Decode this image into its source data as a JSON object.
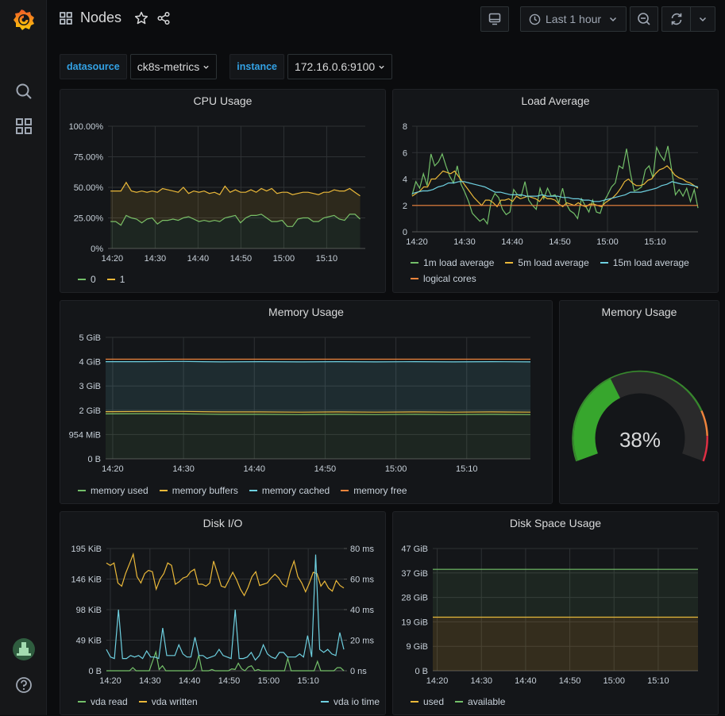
{
  "app": {
    "title": "Nodes"
  },
  "toolbar": {
    "time_range": "Last 1 hour"
  },
  "variables": [
    {
      "label": "datasource",
      "value": "ck8s-metrics"
    },
    {
      "label": "instance",
      "value": "172.16.0.6:9100"
    }
  ],
  "colors": {
    "green": "#73bf69",
    "yellow": "#eab839",
    "cyan": "#6ed0e0",
    "orange": "#ef843c",
    "red": "#e02f44",
    "gauge_green": "#37872d"
  },
  "panels": {
    "cpu": {
      "title": "CPU Usage"
    },
    "load": {
      "title": "Load Average"
    },
    "memory": {
      "title": "Memory Usage"
    },
    "memory_gauge": {
      "title": "Memory Usage",
      "value_text": "38%"
    },
    "diskio": {
      "title": "Disk I/O"
    },
    "diskspace": {
      "title": "Disk Space Usage"
    }
  },
  "chart_data": [
    {
      "id": "cpu",
      "type": "area",
      "title": "CPU Usage",
      "x": [
        "14:20",
        "14:30",
        "14:40",
        "14:50",
        "15:00",
        "15:10"
      ],
      "xlim": [
        "14:19",
        "15:19"
      ],
      "yticks": [
        "0%",
        "25.00%",
        "50.00%",
        "75.00%",
        "100.00%"
      ],
      "ylim": [
        0,
        100
      ],
      "stacked": true,
      "series": [
        {
          "name": "0",
          "color": "#73bf69",
          "values": [
            22,
            22,
            19,
            27,
            25,
            24,
            21,
            24,
            25,
            20,
            23,
            23,
            24,
            23,
            25,
            26,
            24,
            22,
            23,
            22,
            23,
            22,
            25,
            26,
            27,
            21,
            25,
            27,
            27,
            28,
            25,
            22,
            22,
            23,
            18,
            18,
            24,
            25,
            25,
            22,
            22,
            25,
            26,
            27,
            24,
            23,
            28,
            28,
            24
          ]
        },
        {
          "name": "1",
          "color": "#eab839",
          "values": [
            25,
            25,
            28,
            27,
            22,
            22,
            26,
            22,
            22,
            26,
            26,
            25,
            23,
            23,
            25,
            19,
            23,
            24,
            24,
            23,
            23,
            22,
            26,
            20,
            21,
            25,
            21,
            21,
            19,
            21,
            22,
            27,
            23,
            23,
            28,
            26,
            21,
            21,
            21,
            23,
            22,
            21,
            20,
            21,
            23,
            24,
            21,
            18,
            19
          ]
        }
      ],
      "legend": [
        "0",
        "1"
      ]
    },
    {
      "id": "load",
      "type": "line",
      "title": "Load Average",
      "x": [
        "14:20",
        "14:30",
        "14:40",
        "14:50",
        "15:00",
        "15:10"
      ],
      "yticks": [
        "0",
        "2",
        "4",
        "6",
        "8"
      ],
      "ylim": [
        0,
        8
      ],
      "series": [
        {
          "name": "1m load average",
          "color": "#73bf69",
          "values": [
            2.8,
            3.8,
            3.3,
            4.4,
            3.5,
            5.9,
            5.0,
            5.3,
            5.9,
            5.0,
            4.2,
            3.7,
            5.0,
            3.6,
            3.0,
            2.3,
            1.4,
            1.1,
            0.8,
            1.0,
            0.6,
            2.3,
            2.9,
            2.6,
            1.7,
            1.3,
            1.5,
            3.2,
            2.8,
            2.7,
            3.8,
            2.4,
            2.0,
            1.7,
            3.3,
            2.5,
            3.3,
            2.7,
            2.8,
            2.2,
            3.3,
            2.1,
            1.6,
            1.4,
            1.0,
            2.5,
            2.0,
            1.5,
            2.4,
            1.5,
            1.4,
            2.3,
            2.8,
            3.4,
            3.7,
            5.0,
            4.8,
            6.3,
            4.5,
            3.1,
            3.2,
            3.4,
            4.7,
            5.0,
            4.1,
            6.4,
            5.8,
            5.4,
            6.5,
            4.7,
            2.8,
            3.2,
            2.7,
            3.3,
            2.3,
            3.2,
            1.8
          ]
        },
        {
          "name": "5m load average",
          "color": "#eab839",
          "values": [
            2.7,
            2.9,
            3.1,
            3.4,
            3.4,
            4.0,
            4.0,
            4.3,
            4.6,
            4.5,
            4.4,
            4.6,
            4.2,
            3.8,
            3.4,
            3.0,
            2.6,
            2.3,
            2.0,
            2.4,
            2.4,
            2.2,
            1.9,
            2.4,
            2.4,
            2.5,
            2.3,
            2.7,
            2.5,
            2.6,
            2.7,
            2.6,
            2.5,
            2.3,
            2.7,
            2.5,
            2.5,
            2.4,
            2.1,
            1.9,
            2.2,
            2.1,
            2.0,
            2.2,
            2.0,
            1.9,
            2.1,
            2.1,
            2.0,
            1.9,
            2.2,
            2.4,
            2.6,
            2.9,
            3.3,
            3.8,
            4.0,
            3.7,
            3.5,
            3.5,
            3.6,
            3.9,
            4.0,
            4.4,
            4.7,
            4.8,
            5.0,
            4.7,
            4.3,
            4.1,
            4.0,
            3.8,
            3.7,
            3.5,
            3.3
          ]
        },
        {
          "name": "15m load average",
          "color": "#6ed0e0",
          "values": [
            2.9,
            3.0,
            3.1,
            3.1,
            3.2,
            3.4,
            3.5,
            3.7,
            3.7,
            3.8,
            3.8,
            3.7,
            3.6,
            3.5,
            3.4,
            3.2,
            3.0,
            3.0,
            2.9,
            2.8,
            2.8,
            2.8,
            2.7,
            2.7,
            2.7,
            2.8,
            2.7,
            2.7,
            2.7,
            2.6,
            2.6,
            2.5,
            2.5,
            2.4,
            2.4,
            2.3,
            2.3,
            2.4,
            2.5,
            2.6,
            2.7,
            2.8,
            3.0,
            3.0,
            3.0,
            3.1,
            3.2,
            3.3,
            3.5,
            3.6,
            3.8,
            3.7,
            3.6,
            3.6,
            3.5,
            3.4
          ]
        },
        {
          "name": "logical cores",
          "color": "#ef843c",
          "values": [
            2,
            2
          ]
        }
      ],
      "legend": [
        "1m load average",
        "5m load average",
        "15m load average",
        "logical cores"
      ]
    },
    {
      "id": "memory",
      "type": "area",
      "title": "Memory Usage",
      "x": [
        "14:20",
        "14:30",
        "14:40",
        "14:50",
        "15:00",
        "15:10"
      ],
      "yticks": [
        "0 B",
        "954 MiB",
        "2 GiB",
        "3 GiB",
        "4 GiB",
        "5 GiB"
      ],
      "ylim_gib": [
        0,
        5
      ],
      "series": [
        {
          "name": "memory used",
          "color": "#73bf69",
          "values_gib": [
            1.85,
            1.86,
            1.85,
            1.83,
            1.83,
            1.82,
            1.83,
            1.82,
            1.83,
            1.82,
            1.83,
            1.82
          ]
        },
        {
          "name": "memory buffers",
          "color": "#eab839",
          "values_gib": [
            1.94,
            1.95,
            1.95,
            1.93,
            1.93,
            1.92,
            1.93,
            1.92,
            1.93,
            1.92,
            1.93,
            1.92
          ]
        },
        {
          "name": "memory cached",
          "color": "#6ed0e0",
          "values_gib": [
            4.0,
            4.0,
            4.01,
            3.99,
            4.0,
            3.99,
            4.0,
            3.99,
            4.0,
            3.99,
            4.0,
            3.99
          ]
        },
        {
          "name": "memory free",
          "color": "#ef843c",
          "values_gib": [
            4.1,
            4.1
          ]
        }
      ],
      "legend": [
        "memory used",
        "memory buffers",
        "memory cached",
        "memory free"
      ]
    },
    {
      "id": "memory_gauge",
      "type": "gauge",
      "title": "Memory Usage",
      "value_percent": 38,
      "thresholds": [
        {
          "from": 0,
          "color": "#37872d"
        },
        {
          "from": 80,
          "color": "#ef843c"
        },
        {
          "from": 90,
          "color": "#e02f44"
        }
      ]
    },
    {
      "id": "diskio",
      "type": "line",
      "title": "Disk I/O",
      "x": [
        "14:20",
        "14:30",
        "14:40",
        "14:50",
        "15:00",
        "15:10"
      ],
      "yticks_left": [
        "0 B",
        "49 KiB",
        "98 KiB",
        "146 KiB",
        "195 KiB"
      ],
      "ylim_left_kib": [
        0,
        195
      ],
      "yticks_right": [
        "0 ns",
        "20 ms",
        "40 ms",
        "60 ms",
        "80 ms"
      ],
      "ylim_right_ms": [
        0,
        80
      ],
      "series": [
        {
          "name": "vda read",
          "color": "#73bf69",
          "axis": "left",
          "values": [
            0,
            0,
            0,
            0,
            0,
            0,
            0,
            0,
            5,
            0,
            0,
            0,
            0,
            0,
            15,
            30,
            2,
            8,
            0,
            0,
            0,
            0,
            0,
            0,
            0,
            0,
            0,
            5,
            25,
            0,
            0,
            0,
            2,
            0,
            0,
            0,
            0,
            0,
            3,
            2,
            12,
            3,
            0,
            6,
            8,
            0,
            2,
            0,
            0,
            0,
            0,
            0,
            0,
            0,
            0,
            20,
            0,
            0,
            0,
            0,
            0,
            0,
            0,
            0,
            15,
            0,
            0,
            0,
            0,
            0,
            5,
            5,
            0
          ]
        },
        {
          "name": "vda written",
          "color": "#eab839",
          "axis": "left",
          "values": [
            172,
            168,
            172,
            140,
            135,
            155,
            170,
            186,
            150,
            140,
            155,
            160,
            158,
            130,
            146,
            155,
            172,
            168,
            138,
            142,
            148,
            150,
            158,
            162,
            138,
            138,
            135,
            140,
            175,
            155,
            135,
            133,
            145,
            157,
            145,
            130,
            120,
            133,
            150,
            158,
            136,
            138,
            140,
            148,
            154,
            148,
            138,
            134,
            158,
            175,
            150,
            140,
            126,
            140,
            157,
            155,
            135,
            143,
            132,
            127,
            144,
            136,
            132
          ]
        },
        {
          "name": "vda io time",
          "color": "#6ed0e0",
          "axis": "right",
          "values": [
            14,
            9,
            8,
            40,
            8,
            8,
            10,
            9,
            10,
            8,
            13,
            9,
            9,
            8,
            28,
            10,
            10,
            10,
            17,
            11,
            9,
            9,
            22,
            10,
            10,
            8,
            9,
            10,
            14,
            10,
            9,
            8,
            40,
            8,
            8,
            9,
            12,
            7,
            10,
            17,
            11,
            9,
            8,
            12,
            12,
            9,
            9,
            9,
            11,
            9,
            23,
            9,
            76,
            14,
            12,
            14,
            11,
            10,
            25,
            14
          ]
        }
      ],
      "legend": [
        "vda read",
        "vda written",
        "vda io time"
      ]
    },
    {
      "id": "diskspace",
      "type": "area",
      "title": "Disk Space Usage",
      "x": [
        "14:20",
        "14:30",
        "14:40",
        "14:50",
        "15:00",
        "15:10"
      ],
      "yticks": [
        "0 B",
        "9 GiB",
        "19 GiB",
        "28 GiB",
        "37 GiB",
        "47 GiB"
      ],
      "ylim_gib": [
        0,
        47
      ],
      "series": [
        {
          "name": "used",
          "color": "#eab839",
          "values_gib": [
            20.6,
            20.6
          ]
        },
        {
          "name": "available",
          "color": "#73bf69",
          "values_gib": [
            39.0,
            39.0
          ]
        }
      ],
      "legend": [
        "used",
        "available"
      ]
    }
  ]
}
